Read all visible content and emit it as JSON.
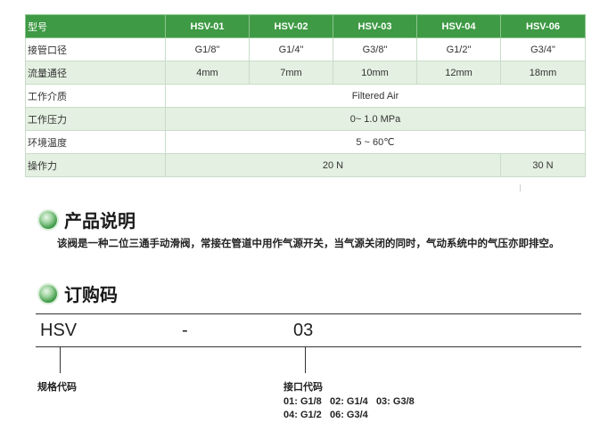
{
  "spec_table": {
    "header": [
      "型号",
      "HSV-01",
      "HSV-02",
      "HSV-03",
      "HSV-04",
      "HSV-06"
    ],
    "port": {
      "label": "接管口径",
      "values": [
        "G1/8\"",
        "G1/4\"",
        "G3/8\"",
        "G1/2\"",
        "G3/4\""
      ]
    },
    "flow": {
      "label": "流量通径",
      "values": [
        "4mm",
        "7mm",
        "10mm",
        "12mm",
        "18mm"
      ]
    },
    "medium": {
      "label": "工作介质",
      "value": "Filtered Air"
    },
    "pressure": {
      "label": "工作压力",
      "value": "0~ 1.0 MPa"
    },
    "temperature": {
      "label": "环境温度",
      "value": "5 ~ 60℃"
    },
    "force": {
      "label": "操作力",
      "value_main": "20 N",
      "value_last": "30 N"
    }
  },
  "description": {
    "title": "产品说明",
    "text": "该阀是一种二位三通手动滑阀，常接在管道中用作气源开关，当气源关闭的同时，气动系统中的气压亦即排空。"
  },
  "order_code": {
    "title": "订购码",
    "series": "HSV",
    "dash": "-",
    "port": "03",
    "series_label": "规格代码",
    "port_label": "接口代码",
    "options_line1": "01: G1/8   02: G1/4   03: G3/8",
    "options_line2": "04: G1/2   06: G3/4"
  },
  "colors": {
    "header_green": "#3e9a44",
    "row_tint": "#e4f0e1"
  }
}
